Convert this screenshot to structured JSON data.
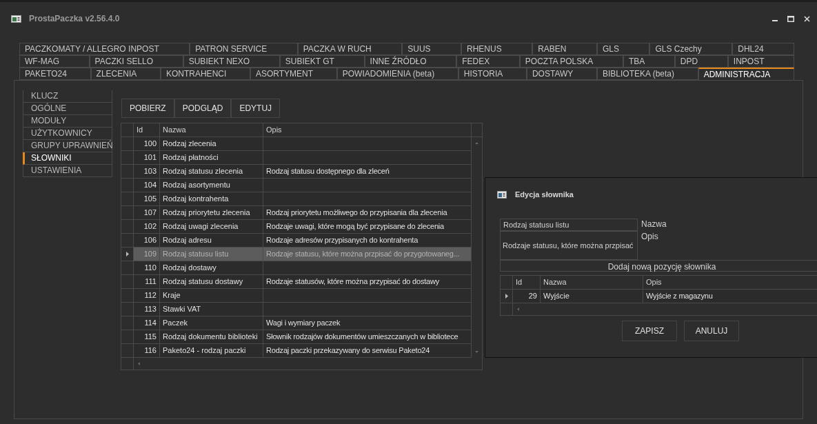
{
  "window": {
    "title": "ProstaPaczka v2.56.4.0"
  },
  "tab_rows": [
    [
      {
        "label": "PACZKOMATY / ALLEGRO INPOST",
        "selected": false
      },
      {
        "label": "PATRON SERVICE",
        "selected": false
      },
      {
        "label": "PACZKA W RUCH",
        "selected": false
      },
      {
        "label": "SUUS",
        "selected": false
      },
      {
        "label": "RHENUS",
        "selected": false
      },
      {
        "label": "RABEN",
        "selected": false
      },
      {
        "label": "GLS",
        "selected": false
      },
      {
        "label": "GLS Czechy",
        "selected": false
      },
      {
        "label": "DHL24",
        "selected": false
      }
    ],
    [
      {
        "label": "WF-MAG",
        "selected": false
      },
      {
        "label": "PACZKI SELLO",
        "selected": false
      },
      {
        "label": "SUBIEKT NEXO",
        "selected": false
      },
      {
        "label": "SUBIEKT GT",
        "selected": false
      },
      {
        "label": "INNE ŹRÓDŁO",
        "selected": false
      },
      {
        "label": "FEDEX",
        "selected": false
      },
      {
        "label": "POCZTA POLSKA",
        "selected": false
      },
      {
        "label": "TBA",
        "selected": false
      },
      {
        "label": "DPD",
        "selected": false
      },
      {
        "label": "INPOST",
        "selected": false
      }
    ],
    [
      {
        "label": "PAKETO24",
        "selected": false
      },
      {
        "label": "ZLECENIA",
        "selected": false
      },
      {
        "label": "KONTRAHENCI",
        "selected": false
      },
      {
        "label": "ASORTYMENT",
        "selected": false
      },
      {
        "label": "POWIADOMIENIA (beta)",
        "selected": false
      },
      {
        "label": "HISTORIA",
        "selected": false
      },
      {
        "label": "DOSTAWY",
        "selected": false
      },
      {
        "label": "BIBLIOTEKA (beta)",
        "selected": false
      },
      {
        "label": "ADMINISTRACJA",
        "selected": true
      }
    ]
  ],
  "sidebar": {
    "items": [
      {
        "label": "KLUCZ",
        "selected": false
      },
      {
        "label": "OGÓLNE",
        "selected": false
      },
      {
        "label": "MODUŁY",
        "selected": false
      },
      {
        "label": "UŻYTKOWNICY",
        "selected": false
      },
      {
        "label": "GRUPY UPRAWNIEŃ",
        "selected": false
      },
      {
        "label": "SŁOWNIKI",
        "selected": true
      },
      {
        "label": "USTAWIENIA",
        "selected": false
      }
    ]
  },
  "toolbar": {
    "buttons": [
      "POBIERZ",
      "PODGLĄD",
      "EDYTUJ"
    ]
  },
  "table": {
    "columns": [
      "Id",
      "Nazwa",
      "Opis"
    ],
    "rows": [
      {
        "id": "100",
        "name": "Rodzaj zlecenia",
        "selected": false
      },
      {
        "id": "101",
        "name": "Rodzaj płatności",
        "selected": false
      },
      {
        "id": "103",
        "name": "Rodzaj statusu zlecenia",
        "description": "Rodzaj statusu dostępnego dla zleceń",
        "selected": false
      },
      {
        "id": "104",
        "name": "Rodzaj asortymentu",
        "selected": false
      },
      {
        "id": "105",
        "name": "Rodzaj kontrahenta",
        "selected": false
      },
      {
        "id": "107",
        "name": "Rodzaj priorytetu zlecenia",
        "description": "Rodzaj priorytetu możliwego do przypisania dla zlecenia",
        "selected": false
      },
      {
        "id": "102",
        "name": "Rodzaj uwagi zlecenia",
        "description": "Rodzaje uwagi, które mogą być przypisane do zlecenia",
        "selected": false
      },
      {
        "id": "106",
        "name": "Rodzaj adresu",
        "description": "Rodzaje adresów przypisanych do kontrahenta",
        "selected": false
      },
      {
        "id": "109",
        "name": "Rodzaj statusu listu",
        "description": "Rodzaje statusu, które można przpisać do przygotowaneg...",
        "selected": true
      },
      {
        "id": "110",
        "name": "Rodzaj dostawy",
        "selected": false
      },
      {
        "id": "111",
        "name": "Rodzaj statusu dostawy",
        "description": "Rodzaje statusów, które można przypisać do dostawy",
        "selected": false
      },
      {
        "id": "112",
        "name": "Kraje",
        "selected": false
      },
      {
        "id": "113",
        "name": "Stawki VAT",
        "selected": false
      },
      {
        "id": "114",
        "name": "Paczek",
        "description": "Wagi i wymiary paczek",
        "selected": false
      },
      {
        "id": "115",
        "name": "Rodzaj dokumentu biblioteki",
        "description": "Słownik rodzajów dokumentów umieszczanych w bibliotece",
        "selected": false
      },
      {
        "id": "116",
        "name": "Paketo24 - rodzaj paczki",
        "description": "Rodzaj paczki przekazywany do serwisu Paketo24",
        "selected": false
      }
    ]
  },
  "dialog": {
    "title": "Edycja słownika",
    "fields": [
      {
        "kind": "input",
        "label": "Nazwa",
        "value": "Rodzaj statusu listu"
      },
      {
        "kind": "textarea",
        "label": "Opis",
        "value": "Rodzaje statusu, które można przpisać"
      }
    ],
    "add_button": "Dodaj nową pozycję słownika",
    "table": {
      "columns": [
        "Id",
        "Nazwa",
        "Opis"
      ],
      "rows": [
        {
          "id": "29",
          "name": "Wyjście",
          "description": "Wyjście z magazynu",
          "current": true
        }
      ]
    },
    "buttons": [
      "ZAPISZ",
      "ANULUJ"
    ]
  }
}
